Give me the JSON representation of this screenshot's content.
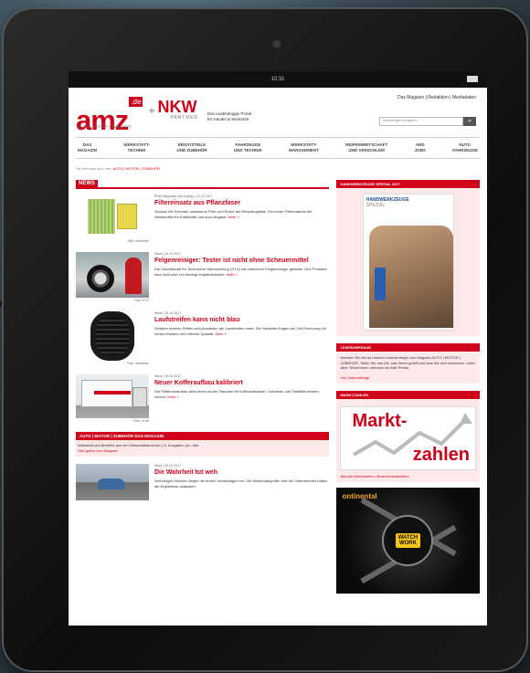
{
  "statusbar": {
    "time": "10:31"
  },
  "logo": {
    "main": "amz",
    "tld": ".de",
    "sub": "AUTO | MOTOR | ZUBEHÖR"
  },
  "partner": {
    "plus": "+",
    "name": "NKW",
    "sub": "PARTNER"
  },
  "tagline": "Das unabhängige Portal für Handel & Werkstatt",
  "topnav": [
    "Das Magazin",
    "Redaktion",
    "Mediadaten"
  ],
  "search": {
    "placeholder": "Suchbegriff eingeben",
    "button": "»"
  },
  "mainnav": [
    {
      "line1": "DAS",
      "line2": "MAGAZIN"
    },
    {
      "line1": "WERKSTATT-",
      "line2": "TECHNIK"
    },
    {
      "line1": "ERSATZTEILE",
      "line2": "UND ZUBEHÖR"
    },
    {
      "line1": "FAHRZEUGE",
      "line2": "UND TECHNIK"
    },
    {
      "line1": "WERKSTATT-",
      "line2": "MANAGEMENT"
    },
    {
      "line1": "REIFENWIRTSCHAFT",
      "line2": "UND VERSCHLEIß"
    },
    {
      "line1": "ARD",
      "line2": "JOBS"
    },
    {
      "line1": "NUTZ-",
      "line2": "FAHRZEUGE"
    }
  ],
  "breadcrumb": {
    "prefix": "Sie befinden sich hier: ",
    "current": "AUTO | MOTOR | ZUBEHÖR"
  },
  "news": {
    "header": "NEWS",
    "items": [
      {
        "meta": "PKW-Reparatur und Aufbau | 01.11.2017",
        "title": "Filtereinsatz aus Pflanzfaser",
        "text": "Schluss mit Schmutz, klassische Filter und Rohre auf Recyclingbasis. Ein neuer Filtermaterial mit Werkstoffen für Kraftstoffe und auch Abgase.",
        "more": "Mehr »",
        "caption": "Bild: Hersteller"
      },
      {
        "meta": "News | 31.10.2017",
        "title": "Felgenreiniger: Tester ist nicht ohne Scheuermittel",
        "text": "Die Gesellschaft für Technische Überwachung (GTÜ) hat zahlreiche Felgenreiniger getestet. Drei Produkte sind nicht oder nur bedingt empfehlenswert.",
        "more": "Mehr »",
        "caption": "Foto: GTÜ"
      },
      {
        "meta": "News | 31.10.2017",
        "title": "Laufstreifen kann nicht blau",
        "text": "Seitdem erzielen Reifen kein Auslaufen der Laufstreifen mehr. Die Hersteller tragen der Zeit Rechnung mit neuen Mustern und höherer Qualität.",
        "more": "Mehr »",
        "caption": "Foto: Hersteller"
      },
      {
        "meta": "News | 30.10.2017",
        "title": "Neuer Kofferaufbau kalibriert",
        "text": "Die Plattformstruktur setzt einen neuen Standard für Kofferaufbauten. Leichtbau und Stabilität werden vereint.",
        "more": "Mehr »",
        "caption": "Foto: KSW"
      }
    ]
  },
  "magazine_banner": {
    "header": "AUTO | MOTOR | ZUBEHÖR DAS MAGAZIN",
    "text": "Werkstatt und Betriebe aus der Wirtschaftsbranche | 11 Ausgaben pro Jahr",
    "link": "Hier geht's zum Magazin"
  },
  "last_item": {
    "meta": "News | 30.10.2017",
    "title": "Die Wahrheit tut weh",
    "text": "Seit einigen Wochen liegen die ersten Verdächtigen vor. Die Wirtschaftsprüfer und die Unternehmen haben die Ergebnisse analysiert."
  },
  "right": {
    "handwerk_header": "HANDWERKZEUGE SPEZIAL 2017",
    "book_title": "HANDWERKZEUGE",
    "book_subtitle": "SPEZIAL",
    "leser_header": "LESERUMFRAGE",
    "leser_text": "Nehmen Sie teil an unserer Leserumfrage zum Magazin AUTO | MOTOR | ZUBEHÖR. Teilen Sie uns mit, was Ihnen gefällt und was Sie sich wünschen. Unter allen Teilnehmern verlosen wir tolle Preise.",
    "leser_link": "Zur Leserumfrage",
    "markt_header": "MARKTZAHLEN",
    "markt_word1": "Markt-",
    "markt_word2": "zahlen",
    "markt_sub": "Aktuelle Marktzahlen | Branchenstatistiken",
    "ad_brand": "ontinental",
    "ad_badge_line1": "WATCH",
    "ad_badge_line2": "WORK",
    "ad_small": "ONLINE"
  },
  "colors": {
    "accent": "#d0021b",
    "bezel": "#111111"
  }
}
